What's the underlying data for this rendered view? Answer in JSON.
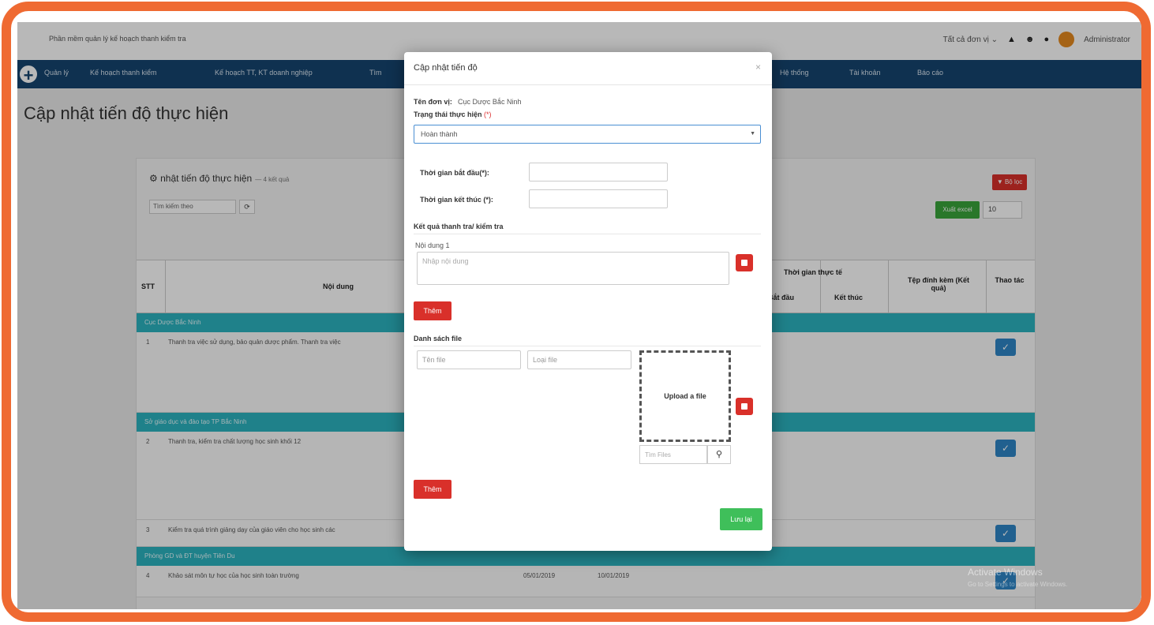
{
  "header": {
    "app_title": "Phần mềm quản lý kế hoạch thanh kiểm tra",
    "unit_select": "Tất cả đơn vị ⌄",
    "user": "Administrator"
  },
  "nav": {
    "items": [
      "Quản lý",
      "Kế hoạch thanh kiểm",
      "Kế hoạch TT, KT doanh nghiệp",
      "Tìm",
      "Hệ thống",
      "Tài khoản",
      "Báo cáo"
    ]
  },
  "page": {
    "title": "Cập nhật tiến độ thực hiện"
  },
  "panel": {
    "title": "nhật tiến độ thực hiện",
    "count": "— 4 kết quả",
    "filter_placeholder": "Tìm kiếm theo",
    "filter_refresh": "⟳",
    "red_button": "▼ Bộ lọc",
    "green_button": "Xuất excel",
    "page_size": "10",
    "table": {
      "headers": {
        "stt": "STT",
        "content": "Nội dung",
        "actual_time": "Thời gian thực tế",
        "start": "Bắt đầu",
        "end": "Kết thúc",
        "attachment": "Tệp đính kèm (Kết quả)",
        "action": "Thao tác"
      },
      "groups": [
        "Cục Dược Bắc Ninh",
        "Sở giáo dục và đào tạo TP Bắc Ninh",
        "Phòng GD và ĐT huyện Tiên Du"
      ],
      "rows": [
        {
          "stt": "1",
          "text": "Thanh tra việc sử dụng, bảo quản dược phẩm. Thanh tra việc",
          "start": "",
          "end": ""
        },
        {
          "stt": "2",
          "text": "Thanh tra, kiểm tra chất lượng học sinh khối 12",
          "start": "",
          "end": ""
        },
        {
          "stt": "3",
          "text": "Kiểm tra quá trình giảng dạy của giáo viên cho học sinh các",
          "start": "",
          "end": ""
        },
        {
          "stt": "4",
          "text": "Khảo sát môn tự học của học sinh toàn trường",
          "start": "05/01/2019",
          "end": "10/01/2019"
        }
      ],
      "check_icon": "✓"
    }
  },
  "modal": {
    "title": "Cập nhật tiến độ",
    "close": "×",
    "unit_label": "Tên đơn vị:",
    "unit_value": "Cục Dược Bắc Ninh",
    "status_label": "Trạng thái thực hiện",
    "status_required": "(*)",
    "status_value": "Hoàn thành",
    "start_label": "Thời gian bắt đầu(*):",
    "end_label": "Thời gian kết thúc (*):",
    "result_section": "Kết quả thanh tra/ kiểm tra",
    "content_label": "Nội dung 1",
    "content_placeholder": "Nhập nội dung",
    "add_label": "Thêm",
    "files_section": "Danh sách file",
    "file_name_placeholder": "Tên file",
    "file_type_placeholder": "Loại file",
    "upload_label": "Upload a file",
    "search_placeholder": "Tìm Files",
    "save_label": "Lưu lại"
  },
  "watermark": {
    "line1": "Activate Windows",
    "line2": "Go to Settings to activate Windows."
  }
}
